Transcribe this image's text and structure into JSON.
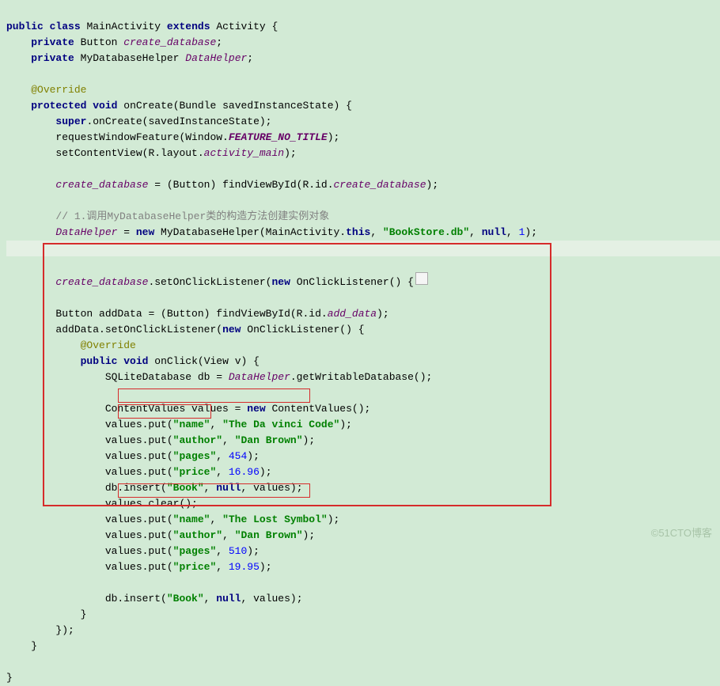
{
  "code": {
    "l1_public": "public",
    "l1_class": "class",
    "l1_name": "MainActivity",
    "l1_extends": "extends",
    "l1_super": "Activity",
    "l1_brace": " {",
    "l2_private": "private",
    "l2_type": "Button",
    "l2_field": "create_database",
    "l2_semi": ";",
    "l3_private": "private",
    "l3_type": "MyDatabaseHelper",
    "l3_field": "DataHelper",
    "l3_semi": ";",
    "l5_ann": "@Override",
    "l6_protected": "protected",
    "l6_void": "void",
    "l6_name": "onCreate",
    "l6_sig": "(Bundle savedInstanceState) {",
    "l7_super": "super",
    "l7_rest": ".onCreate(savedInstanceState);",
    "l8_text": "requestWindowFeature(Window.",
    "l8_const": "FEATURE_NO_TITLE",
    "l8_rest": ");",
    "l9_text": "setContentView(R.layout.",
    "l9_field": "activity_main",
    "l9_rest": ");",
    "l11_field": "create_database",
    "l11_mid": " = (Button) findViewById(R.id.",
    "l11_field2": "create_database",
    "l11_rest": ");",
    "l13_cmt": "// 1.调用MyDatabaseHelper类的构造方法创建实例对象",
    "l14_field": "DataHelper",
    "l14_eq": " = ",
    "l14_new": "new",
    "l14_mid1": " MyDatabaseHelper(MainActivity.",
    "l14_this": "this",
    "l14_mid2": ", ",
    "l14_str": "\"BookStore.db\"",
    "l14_mid3": ", ",
    "l14_null": "null",
    "l14_mid4": ", ",
    "l14_num": "1",
    "l14_rest": ");",
    "l16_field": "create_database",
    "l16_mid": ".setOnClickListener(",
    "l16_new": "new",
    "l16_rest": " OnClickListener() {",
    "l16_collapse": "☐",
    "l18a": "Button addData = (Button) findViewById(R.id.",
    "l18_field": "add_data",
    "l18b": ");",
    "l19a": "addData.setOnClickListener(",
    "l19_new": "new",
    "l19b": " OnClickListener() {",
    "l20_ann": "@Override",
    "l21_public": "public",
    "l21_void": "void",
    "l21_name": "onClick",
    "l21_sig": "(View v) {",
    "l22a": "SQLiteDatabase db = ",
    "l22_field": "DataHelper",
    "l22b": ".getWritableDatabase();",
    "l24a": "ContentValues values = ",
    "l24_new": "new",
    "l24b": " ContentValues();",
    "l25a": "values.put(",
    "l25s1": "\"name\"",
    "l25m": ", ",
    "l25s2": "\"The Da vinci Code\"",
    "l25b": ");",
    "l26a": "values.put(",
    "l26s1": "\"author\"",
    "l26m": ", ",
    "l26s2": "\"Dan Brown\"",
    "l26b": ");",
    "l27a": "values.put(",
    "l27s1": "\"pages\"",
    "l27m": ", ",
    "l27n": "454",
    "l27b": ");",
    "l28a": "values.put(",
    "l28s1": "\"price\"",
    "l28m": ", ",
    "l28n": "16.96",
    "l28b": ");",
    "l29a": "db.insert(",
    "l29s1": "\"Book\"",
    "l29m1": ", ",
    "l29null": "null",
    "l29m2": ", values);",
    "l30": "values.clear();",
    "l31a": "values.put(",
    "l31s1": "\"name\"",
    "l31m": ", ",
    "l31s2": "\"The Lost Symbol\"",
    "l31b": ");",
    "l32a": "values.put(",
    "l32s1": "\"author\"",
    "l32m": ", ",
    "l32s2": "\"Dan Brown\"",
    "l32b": ");",
    "l33a": "values.put(",
    "l33s1": "\"pages\"",
    "l33m": ", ",
    "l33n": "510",
    "l33b": ");",
    "l34a": "values.put(",
    "l34s1": "\"price\"",
    "l34m": ", ",
    "l34n": "19.95",
    "l34b": ");",
    "l36a": "db.insert(",
    "l36s1": "\"Book\"",
    "l36m1": ", ",
    "l36null": "null",
    "l36m2": ", values);",
    "l37": "}",
    "l38": "});",
    "l39": "}",
    "l41": "}"
  },
  "watermark": "©51CTO博客"
}
